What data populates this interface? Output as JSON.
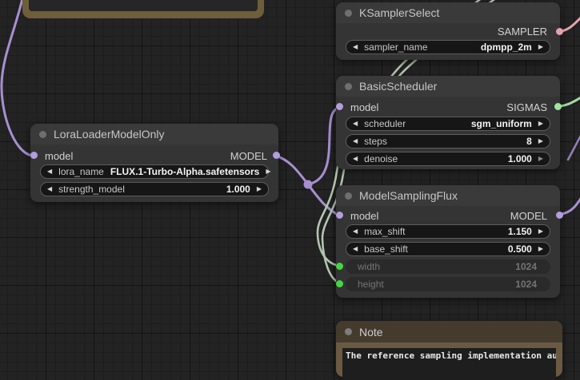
{
  "colors": {
    "wire_model": "#a78fd2",
    "dot_model": "#b39ddb",
    "wire_sampler": "#e4a3b2",
    "dot_sampler": "#e6a0ab",
    "wire_sigmas": "#a5dba5",
    "dot_sigmas": "#9fe5a0",
    "wire_int_pair": "#b3c6af",
    "dot_int": "#41d841",
    "node_background": "#343434",
    "node_titlebar": "#3a3a3a",
    "note_body": "#6a5a43",
    "note_titlebar": "#453b2d",
    "canvas_background": "#232323"
  },
  "icons": {
    "arrow_left": "◀",
    "arrow_right": "▶"
  },
  "ksampler": {
    "title": "KSamplerSelect",
    "output_label": "SAMPLER",
    "widget": {
      "label": "sampler_name",
      "value": "dpmpp_2m"
    }
  },
  "basic_scheduler": {
    "title": "BasicScheduler",
    "input_label": "model",
    "output_label": "SIGMAS",
    "widgets": [
      {
        "label": "scheduler",
        "value": "sgm_uniform"
      },
      {
        "label": "steps",
        "value": "8"
      },
      {
        "label": "denoise",
        "value": "1.000"
      }
    ]
  },
  "lora_loader": {
    "title": "LoraLoaderModelOnly",
    "input_label": "model",
    "output_label": "MODEL",
    "widgets": [
      {
        "label": "lora_name",
        "value": "FLUX.1-Turbo-Alpha.safetensors"
      },
      {
        "label": "strength_model",
        "value": "1.000"
      }
    ]
  },
  "model_sampling_flux": {
    "title": "ModelSamplingFlux",
    "input_label": "model",
    "output_label": "MODEL",
    "widgets": [
      {
        "label": "max_shift",
        "value": "1.150"
      },
      {
        "label": "base_shift",
        "value": "0.500"
      }
    ],
    "converted_inputs": [
      {
        "label": "width",
        "value": "1024"
      },
      {
        "label": "height",
        "value": "1024"
      }
    ]
  },
  "note": {
    "title": "Note",
    "body": "The reference sampling implementation auto adjusts"
  }
}
